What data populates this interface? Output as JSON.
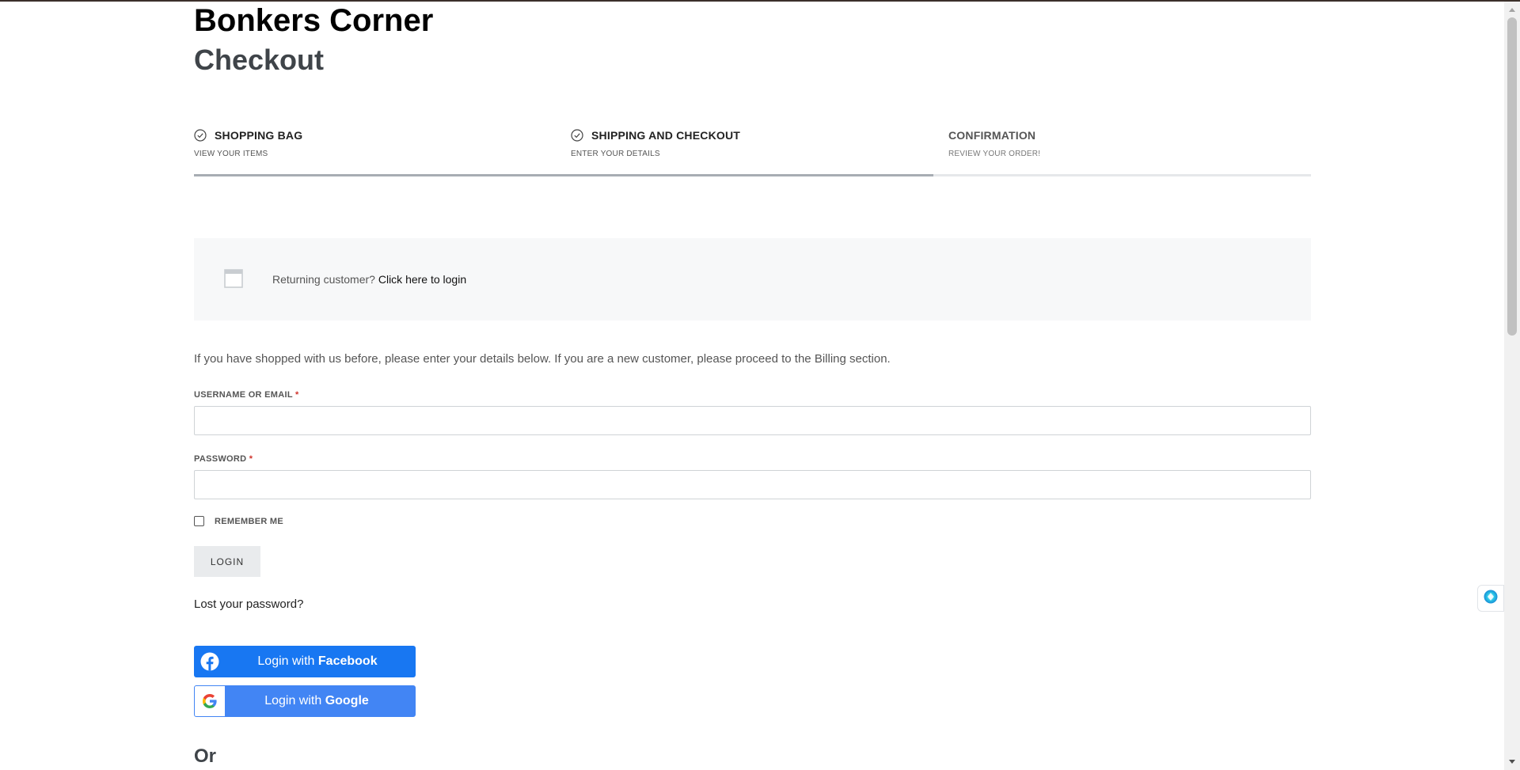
{
  "site": {
    "title": "Bonkers Corner"
  },
  "page": {
    "title": "Checkout"
  },
  "steps": [
    {
      "title": "SHOPPING BAG",
      "subtitle": "VIEW YOUR ITEMS",
      "completed": true
    },
    {
      "title": "SHIPPING AND CHECKOUT",
      "subtitle": "ENTER YOUR DETAILS",
      "completed": true
    },
    {
      "title": "CONFIRMATION",
      "subtitle": "REVIEW YOUR ORDER!",
      "completed": false
    }
  ],
  "progress": {
    "fraction": 0.6617
  },
  "notice": {
    "text": "Returning customer?",
    "link": "Click here to login"
  },
  "intro": "If you have shopped with us before, please enter your details below. If you are a new customer, please proceed to the Billing section.",
  "form": {
    "username_label": "USERNAME OR EMAIL",
    "username_value": "",
    "password_label": "PASSWORD",
    "password_value": "",
    "required_mark": "*",
    "remember_label": "REMEMBER ME",
    "remember_checked": false,
    "login_label": "LOGIN",
    "lost_password": "Lost your password?"
  },
  "social": {
    "facebook_prefix": "Login with",
    "facebook_brand": "Facebook",
    "google_prefix": "Login with",
    "google_brand": "Google"
  },
  "or_text": "Or",
  "colors": {
    "facebook": "#1877f2",
    "google": "#4285f4",
    "notice_bg": "#f7f8f9",
    "progress_fill": "#a7adb3",
    "required": "#d0342c"
  }
}
